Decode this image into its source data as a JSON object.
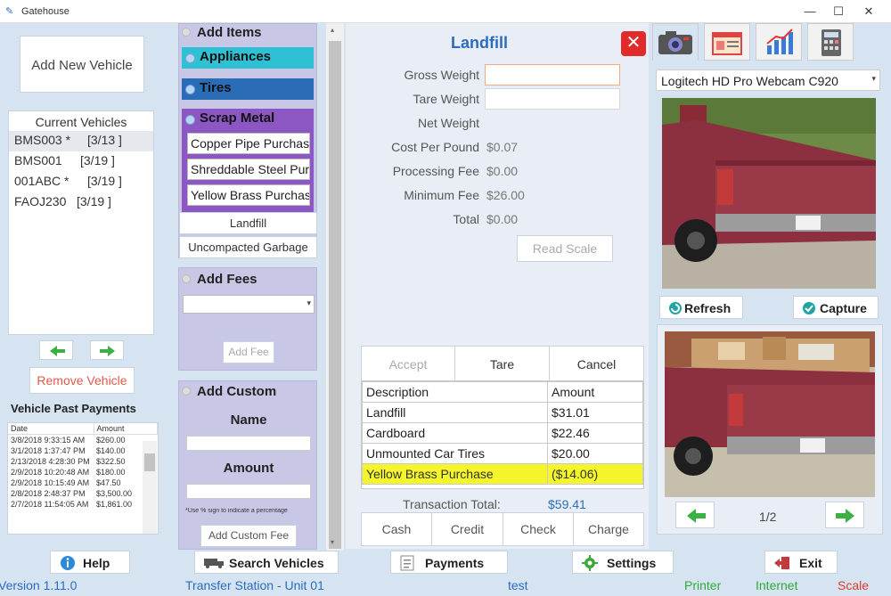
{
  "window": {
    "title": "Gatehouse",
    "min": "—",
    "max": "☐",
    "close": "✕"
  },
  "left": {
    "add_vehicle": "Add New Vehicle",
    "current_vehicles_header": "Current Vehicles",
    "vehicles": [
      {
        "id": "BMS003 *",
        "date": "[3/13 ]"
      },
      {
        "id": "BMS001",
        "date": "[3/19 ]"
      },
      {
        "id": "001ABC *",
        "date": "[3/19 ]"
      },
      {
        "id": "FAOJ230",
        "date": "[3/19 ]"
      }
    ],
    "remove_vehicle": "Remove Vehicle",
    "past_payments_title": "Vehicle Past Payments",
    "payments_header": [
      "Date",
      "Amount"
    ],
    "payments": [
      {
        "date": "3/8/2018 9:33:15 AM",
        "amount": "$260.00"
      },
      {
        "date": "3/1/2018 1:37:47 PM",
        "amount": "$140.00"
      },
      {
        "date": "2/13/2018 4:28:30 PM",
        "amount": "$322.50"
      },
      {
        "date": "2/9/2018 10:20:48 AM",
        "amount": "$180.00"
      },
      {
        "date": "2/9/2018 10:15:49 AM",
        "amount": "$47.50"
      },
      {
        "date": "2/8/2018 2:48:37 PM",
        "amount": "$3,500.00"
      },
      {
        "date": "2/7/2018 11:54:05 AM",
        "amount": "$1,861.00"
      }
    ]
  },
  "items": {
    "title": "Add Items",
    "appliances": "Appliances",
    "tires": "Tires",
    "scrap_metal": "Scrap Metal",
    "scrap_items": [
      "Copper Pipe Purchase",
      "Shreddable Steel Purchase",
      "Yellow Brass Purchase"
    ],
    "landfill": "Landfill",
    "uncompacted": "Uncompacted Garbage"
  },
  "fees": {
    "title": "Add Fees",
    "add_fee": "Add Fee"
  },
  "custom": {
    "title": "Add Custom",
    "name_label": "Name",
    "amount_label": "Amount",
    "note": "*Use % sign to indicate a percentage",
    "add_btn": "Add Custom Fee"
  },
  "center": {
    "title": "Landfill",
    "fields": [
      {
        "label": "Gross Weight",
        "value": ""
      },
      {
        "label": "Tare Weight",
        "value": ""
      },
      {
        "label": "Net Weight",
        "value": ""
      },
      {
        "label": "Cost Per Pound",
        "value": "$0.07"
      },
      {
        "label": "Processing Fee",
        "value": "$0.00"
      },
      {
        "label": "Minimum Fee",
        "value": "$26.00"
      },
      {
        "label": "Total",
        "value": "$0.00"
      }
    ],
    "read_scale": "Read Scale",
    "actions": [
      "Accept",
      "Tare",
      "Cancel"
    ],
    "table_header": [
      "Description",
      "Amount"
    ],
    "rows": [
      {
        "desc": "Landfill",
        "amount": "$31.01"
      },
      {
        "desc": "Cardboard",
        "amount": "$22.46"
      },
      {
        "desc": "Unmounted Car Tires",
        "amount": "$20.00"
      },
      {
        "desc": "Yellow Brass Purchase",
        "amount": "($14.06)"
      }
    ],
    "transaction_label": "Transaction Total:",
    "transaction_total": "$59.41",
    "payments": [
      "Cash",
      "Credit",
      "Check",
      "Charge"
    ]
  },
  "right": {
    "camera": "Logitech HD Pro Webcam C920",
    "refresh": "Refresh",
    "capture": "Capture",
    "page": "1/2"
  },
  "bottom": {
    "help": "Help",
    "search": "Search Vehicles",
    "payments": "Payments",
    "settings": "Settings",
    "exit": "Exit"
  },
  "status": {
    "version": "Version 1.11.0",
    "location": "Transfer Station - Unit 01",
    "user": "test",
    "printer": "Printer",
    "internet": "Internet",
    "scale": "Scale",
    "colors": {
      "printer": "#2eaa3a",
      "internet": "#2eaa3a",
      "scale": "#e03b2a",
      "blue": "#2a6cc0"
    }
  }
}
